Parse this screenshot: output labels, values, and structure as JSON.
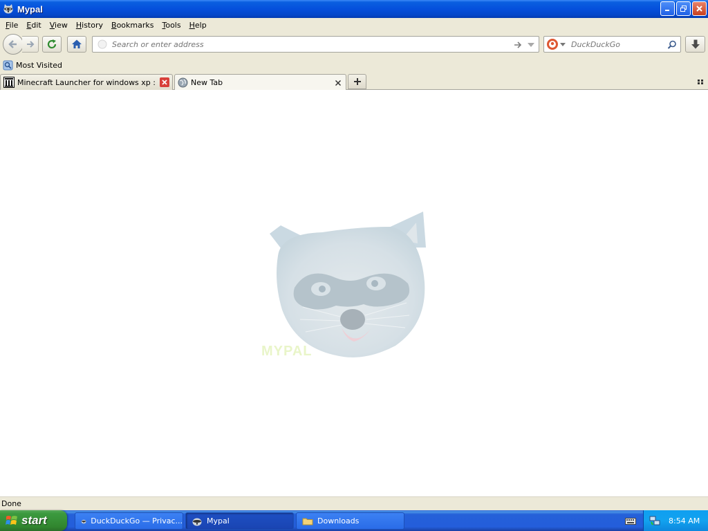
{
  "window": {
    "title": "Mypal"
  },
  "menu": {
    "items": [
      {
        "label": "File",
        "key": "F",
        "rest": "ile"
      },
      {
        "label": "Edit",
        "key": "E",
        "rest": "dit"
      },
      {
        "label": "View",
        "key": "V",
        "rest": "iew"
      },
      {
        "label": "History",
        "key": "H",
        "rest": "istory"
      },
      {
        "label": "Bookmarks",
        "key": "B",
        "rest": "ookmarks"
      },
      {
        "label": "Tools",
        "key": "T",
        "rest": "ools"
      },
      {
        "label": "Help",
        "key": "H",
        "rest": "elp"
      }
    ]
  },
  "navbar": {
    "address_placeholder": "Search or enter address",
    "search_engine": "DuckDuckGo",
    "search_placeholder": "DuckDuckGo"
  },
  "bookmarks": {
    "items": [
      {
        "label": "Most Visited",
        "icon": "bookmark-folder-icon"
      }
    ]
  },
  "tabs": [
    {
      "label": "Minecraft Launcher for windows xp : Fre...",
      "active": false,
      "icon": "archive-org-icon"
    },
    {
      "label": "New Tab",
      "active": true,
      "icon": "globe-icon"
    }
  ],
  "content": {
    "logo_text": "MYPAL"
  },
  "status": {
    "text": "Done"
  },
  "taskbar": {
    "start_label": "start",
    "tasks": [
      {
        "label": "DuckDuckGo — Privac...",
        "active": false,
        "icon": "mypal-icon"
      },
      {
        "label": "Mypal",
        "active": true,
        "icon": "mypal-icon"
      },
      {
        "label": "Downloads",
        "active": false,
        "icon": "folder-icon"
      }
    ],
    "clock": "8:54 AM"
  },
  "colors": {
    "titlebar": "#0550dc",
    "chrome": "#ece9d8",
    "taskbar": "#245edb",
    "start": "#3c9a3f"
  }
}
